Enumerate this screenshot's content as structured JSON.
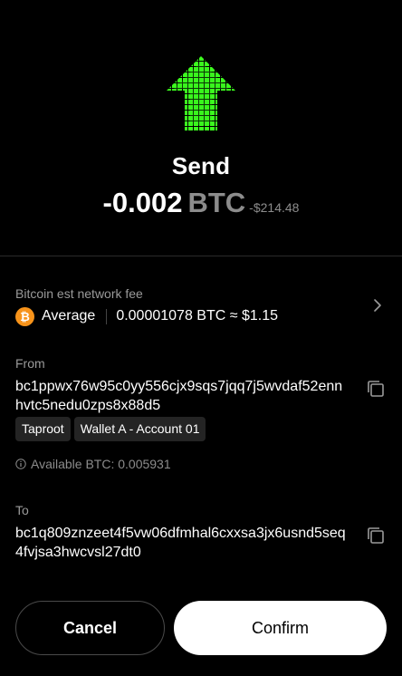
{
  "header": {
    "icon": "arrow-up-icon",
    "icon_color": "#3cff1e",
    "title": "Send",
    "amount": "-0.002",
    "unit": "BTC",
    "usd_value": "-$214.48"
  },
  "fee": {
    "label": "Bitcoin est network fee",
    "icon": "bitcoin-icon",
    "icon_glyph": "₿",
    "icon_color": "#f7931a",
    "speed": "Average",
    "amount": "0.00001078 BTC ≈ $1.15"
  },
  "from": {
    "label": "From",
    "address": "bc1ppwx76w95c0yy556cjx9sqs7jqq7j5wvdaf52ennhvtc5nedu0zps8x88d5",
    "tags": [
      "Taproot",
      "Wallet A - Account 01"
    ],
    "available": "Available BTC: 0.005931"
  },
  "to": {
    "label": "To",
    "address": "bc1q809znzeet4f5vw06dfmhal6cxxsa3jx6usnd5seq4fvjsa3hwcvsl27dt0"
  },
  "actions": {
    "cancel_label": "Cancel",
    "confirm_label": "Confirm"
  }
}
